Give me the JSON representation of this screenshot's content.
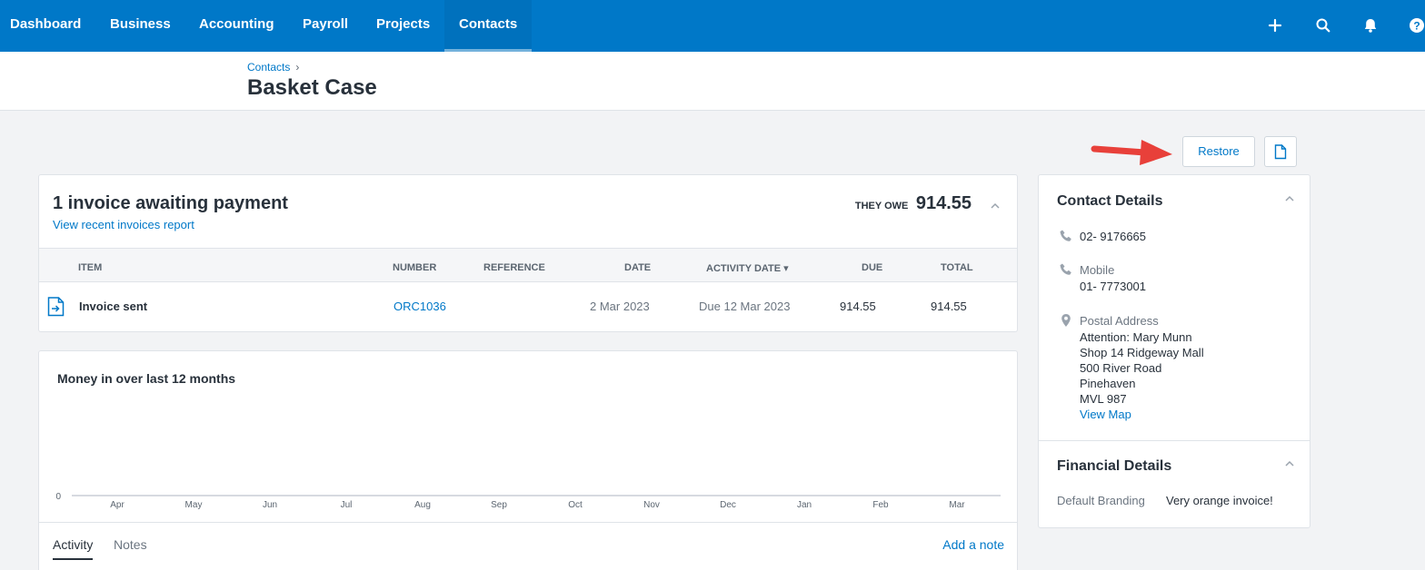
{
  "nav": {
    "items": [
      "Dashboard",
      "Business",
      "Accounting",
      "Payroll",
      "Projects",
      "Contacts"
    ],
    "active": "Contacts",
    "icons": [
      "plus-icon",
      "search-icon",
      "bell-icon",
      "help-icon"
    ]
  },
  "breadcrumb": {
    "parent": "Contacts",
    "separator": "›"
  },
  "page": {
    "title": "Basket Case"
  },
  "actions": {
    "restore_label": "Restore"
  },
  "invoices": {
    "title": "1 invoice awaiting payment",
    "report_link": "View recent invoices report",
    "they_owe_label": "THEY OWE",
    "they_owe_amount": "914.55",
    "columns": {
      "item": "ITEM",
      "number": "NUMBER",
      "reference": "REFERENCE",
      "date": "DATE",
      "activity_date": "ACTIVITY DATE",
      "due": "DUE",
      "total": "TOTAL"
    },
    "rows": [
      {
        "item": "Invoice sent",
        "number": "ORC1036",
        "reference": "",
        "date": "2 Mar 2023",
        "activity_date": "Due 12 Mar 2023",
        "due": "914.55",
        "total": "914.55"
      }
    ]
  },
  "money_in": {
    "title": "Money in over last 12 months"
  },
  "chart_data": {
    "type": "bar",
    "title": "Money in over last 12 months",
    "categories": [
      "Apr",
      "May",
      "Jun",
      "Jul",
      "Aug",
      "Sep",
      "Oct",
      "Nov",
      "Dec",
      "Jan",
      "Feb",
      "Mar"
    ],
    "values": [
      0,
      0,
      0,
      0,
      0,
      0,
      0,
      0,
      0,
      0,
      0,
      0
    ],
    "y_tick": "0",
    "ylim": [
      0,
      0
    ],
    "grid": false
  },
  "tabs": {
    "activity": "Activity",
    "notes": "Notes",
    "add_note": "Add a note"
  },
  "contact_details": {
    "title": "Contact Details",
    "phone": "02- 9176665",
    "mobile_label": "Mobile",
    "mobile": "01- 7773001",
    "postal_label": "Postal Address",
    "address_lines": [
      "Attention: Mary Munn",
      "Shop 14 Ridgeway Mall",
      "500 River Road",
      "Pinehaven",
      "MVL 987"
    ],
    "view_map": "View Map"
  },
  "financial_details": {
    "title": "Financial Details",
    "branding_label": "Default Branding",
    "branding_value": "Very orange invoice!"
  },
  "colors": {
    "brand": "#0078c8",
    "arrow": "#e8403a",
    "text": "#28313b"
  }
}
